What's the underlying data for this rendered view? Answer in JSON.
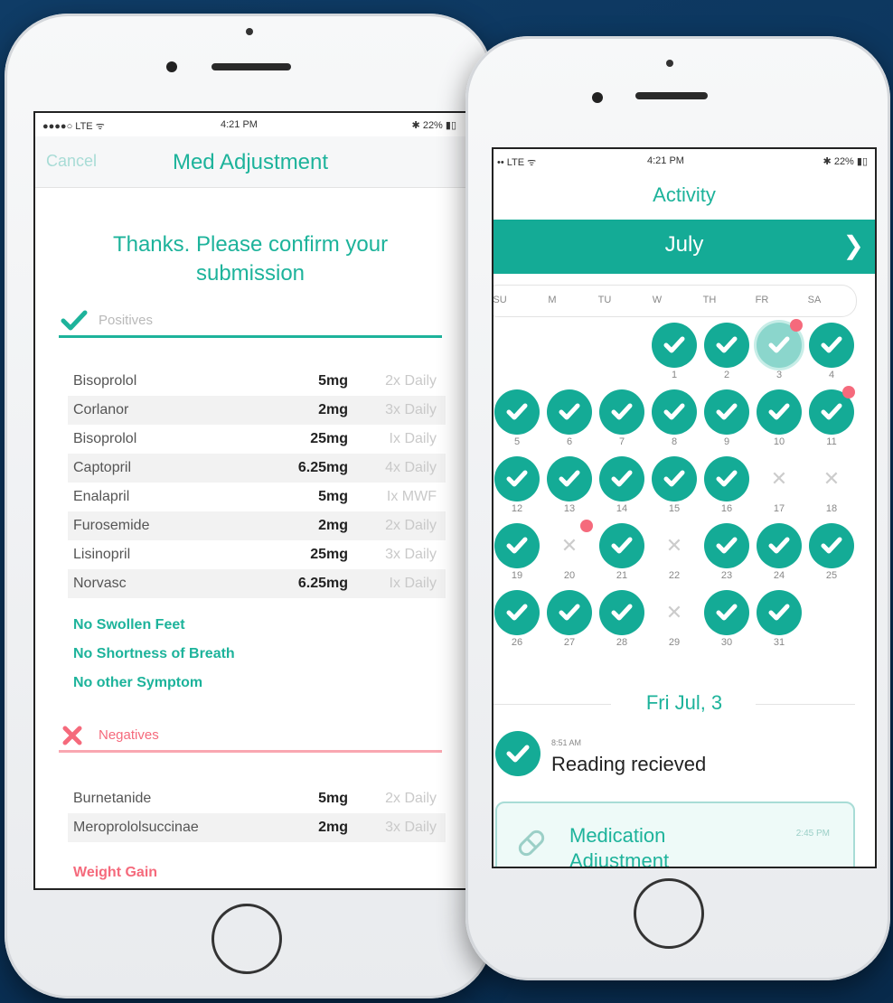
{
  "left": {
    "status": {
      "carrier": "●●●●○ LTE ᯤ",
      "time": "4:21 PM",
      "battery": "✱ 22% ▮▯"
    },
    "nav": {
      "cancel": "Cancel",
      "title": "Med Adjustment"
    },
    "confirm_title": "Thanks. Please confirm your submission",
    "positives": {
      "label": "Positives",
      "meds": [
        {
          "name": "Bisoprolol",
          "dose": "5mg",
          "freq": "2x Daily"
        },
        {
          "name": "Corlanor",
          "dose": "2mg",
          "freq": "3x Daily"
        },
        {
          "name": "Bisoprolol",
          "dose": "25mg",
          "freq": "Ix Daily"
        },
        {
          "name": "Captopril",
          "dose": "6.25mg",
          "freq": "4x Daily"
        },
        {
          "name": "Enalapril",
          "dose": "5mg",
          "freq": "Ix MWF"
        },
        {
          "name": "Furosemide",
          "dose": "2mg",
          "freq": "2x Daily"
        },
        {
          "name": "Lisinopril",
          "dose": "25mg",
          "freq": "3x Daily"
        },
        {
          "name": "Norvasc",
          "dose": "6.25mg",
          "freq": "Ix Daily"
        }
      ],
      "symptoms": [
        "No Swollen Feet",
        "No Shortness of Breath",
        "No other Symptom"
      ]
    },
    "negatives": {
      "label": "Negatives",
      "meds": [
        {
          "name": "Burnetanide",
          "dose": "5mg",
          "freq": "2x Daily"
        },
        {
          "name": "Meroprololsuccinae",
          "dose": "2mg",
          "freq": "3x Daily"
        }
      ],
      "symptoms": [
        "Weight Gain"
      ]
    },
    "colors": {
      "accent": "#1db39b",
      "negative": "#f56a7c"
    }
  },
  "right": {
    "status": {
      "carrier": "•• LTE ᯤ",
      "time": "4:21 PM",
      "battery": "✱ 22% ▮▯"
    },
    "nav_title": "Activity",
    "month": "July",
    "weekdays": [
      "SU",
      "M",
      "TU",
      "W",
      "TH",
      "FR",
      "SA"
    ],
    "days": [
      {
        "n": "1",
        "s": "check"
      },
      {
        "n": "2",
        "s": "check"
      },
      {
        "n": "3",
        "s": "selected",
        "dot": true
      },
      {
        "n": "4",
        "s": "check"
      },
      {
        "n": "5",
        "s": "check"
      },
      {
        "n": "6",
        "s": "check"
      },
      {
        "n": "7",
        "s": "check"
      },
      {
        "n": "8",
        "s": "check"
      },
      {
        "n": "9",
        "s": "check"
      },
      {
        "n": "10",
        "s": "check"
      },
      {
        "n": "11",
        "s": "check",
        "dot": true
      },
      {
        "n": "12",
        "s": "check"
      },
      {
        "n": "13",
        "s": "check"
      },
      {
        "n": "14",
        "s": "check"
      },
      {
        "n": "15",
        "s": "check"
      },
      {
        "n": "16",
        "s": "check"
      },
      {
        "n": "17",
        "s": "x"
      },
      {
        "n": "18",
        "s": "x"
      },
      {
        "n": "19",
        "s": "check"
      },
      {
        "n": "20",
        "s": "x",
        "dot": true
      },
      {
        "n": "21",
        "s": "check"
      },
      {
        "n": "22",
        "s": "x"
      },
      {
        "n": "23",
        "s": "check"
      },
      {
        "n": "24",
        "s": "check"
      },
      {
        "n": "25",
        "s": "check"
      },
      {
        "n": "26",
        "s": "check"
      },
      {
        "n": "27",
        "s": "check"
      },
      {
        "n": "28",
        "s": "check"
      },
      {
        "n": "29",
        "s": "x"
      },
      {
        "n": "30",
        "s": "check"
      },
      {
        "n": "31",
        "s": "check"
      }
    ],
    "selected_date": "Fri Jul, 3",
    "event": {
      "time": "8:51 AM",
      "text": "Reading recieved"
    },
    "card": {
      "title": "Medication Adjustment",
      "time": "2:45 PM",
      "icon": "pill-icon"
    }
  }
}
